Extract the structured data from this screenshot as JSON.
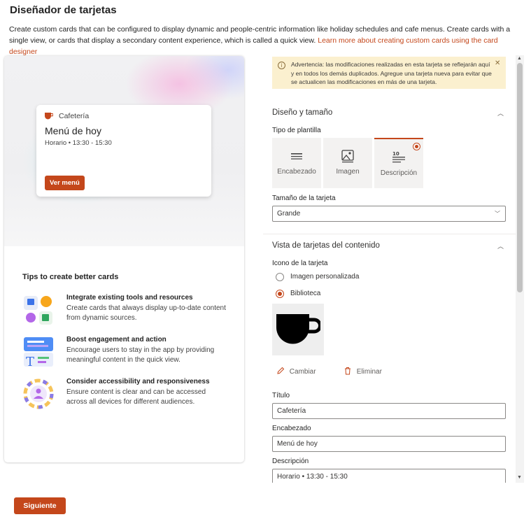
{
  "page": {
    "title": "Diseñador de tarjetas",
    "description": "Create custom cards that can be configured to display dynamic and people-centric information like holiday schedules and cafe menus. Create cards with a single view, or cards that display a secondary content experience, which is called a quick view. ",
    "description_link": "Learn more about creating custom cards using the card designer"
  },
  "preview": {
    "card": {
      "app_name": "Cafetería",
      "title": "Menú de hoy",
      "subtitle": "Horario • 13:30 - 15:30",
      "button_label": "Ver menú"
    },
    "tips_title": "Tips to create better cards",
    "tips": [
      {
        "heading": "Integrate existing tools and resources",
        "text": "Create cards that always display up-to-date content from dynamic sources."
      },
      {
        "heading": "Boost engagement and action",
        "text": "Encourage users to stay in the app by providing meaningful content in the quick view."
      },
      {
        "heading": "Consider accessibility and responsiveness",
        "text": "Ensure content is clear and can be accessed across all devices for different audiences."
      }
    ]
  },
  "form": {
    "warning": {
      "text": "Advertencia: las modificaciones realizadas en esta tarjeta se reflejarán aquí y en todos los demás duplicados. Agregue una tarjeta nueva para evitar que se actualicen las modificaciones en más de una tarjeta.",
      "close_glyph": "✕",
      "icon_glyph": "i"
    },
    "layout_section": {
      "title": "Diseño y tamaño",
      "template_label": "Tipo de plantilla",
      "templates": [
        {
          "label": "Encabezado",
          "selected": false
        },
        {
          "label": "Imagen",
          "selected": false
        },
        {
          "label": "Descripción",
          "selected": true
        }
      ],
      "size_label": "Tamaño de la tarjeta",
      "size_value": "Grande"
    },
    "content_section": {
      "title": "Vista de tarjetas del contenido",
      "icon_label": "Icono de la tarjeta",
      "icon_options": [
        {
          "label": "Imagen personalizada",
          "selected": false
        },
        {
          "label": "Biblioteca",
          "selected": true
        }
      ],
      "change_label": "Cambiar",
      "delete_label": "Eliminar",
      "fields": [
        {
          "label": "Título",
          "value": "Cafetería"
        },
        {
          "label": "Encabezado",
          "value": "Menú de hoy"
        },
        {
          "label": "Descripción",
          "value": "Horario • 13:30 - 15:30"
        }
      ]
    }
  },
  "footer": {
    "next_label": "Siguiente"
  },
  "colors": {
    "accent": "#c4471b",
    "warning_bg": "#fbf0cf"
  }
}
